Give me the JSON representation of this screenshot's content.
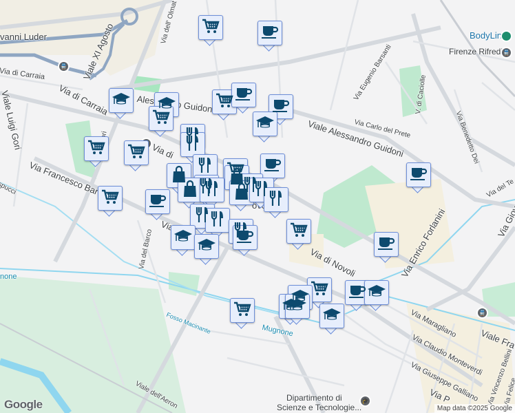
{
  "map": {
    "streets": {
      "giovanni_luder": "vanni Luder",
      "viale_xi_agosto": "Viale XI Agosto",
      "via_olmatello": "Via dell' Olmat",
      "via_di_carraia_1": "Via di Carraia",
      "via_di_carraia_2": "Via di Carraia",
      "viale_luigi_gori": "Viale Luigi Gori",
      "via_allori": "Via Allori",
      "via_francesco_baracca": "Via Francesco Bar",
      "baracca_2": "Via      Baracca",
      "vespucci": "spucci",
      "via_del_barco": "Via del Barco",
      "alessandro_guidoni_1": "Alessandro Guidoni",
      "viale_alessandro_guidoni": "Viale Alessandro Guidoni",
      "via_eugenio_barsanti": "Via Eugenio Barsanti",
      "via_carlo_del_prete": "Via Carlo del Prete",
      "via_di_caciolle": "V. di Caciolle",
      "via_benedetto_dei": "Via Benedetto Dei",
      "via_del_te": "Via del Te",
      "via_giov": "Via Giov",
      "via_di_novoli": "Via di Novoli",
      "via_enrico_forlanini": "Via Enrico Forlanini",
      "via_maragliano": "Via Maragliano",
      "via_claudio_monteverdi": "Via Claudio Monteverdi",
      "via_giuseppe_galliano": "Via Giuseppe Galliano",
      "via_vincenzo_bellini": "Via Vincenzo Bellini",
      "via_felice": "Via Felice",
      "via_p": "Via P",
      "viale_fra": "Viale Fra",
      "viale_dell_aeronautica": "Viale dell'Aeron",
      "fosso_macinante": "Fosso Macinante",
      "mugnone": "Mugnone",
      "mugnone_left": "none",
      "novoli": "ovo",
      "via_di_dup": "Via di"
    },
    "places": {
      "bodyline": "BodyLine",
      "firenze_rifredi": "Firenze Rifredi",
      "dipartimento_1": "Dipartimento di",
      "dipartimento_2": "Scienze e Tecnologie..."
    },
    "attribution": "Map data ©2025 Google",
    "logo": "Google"
  }
}
